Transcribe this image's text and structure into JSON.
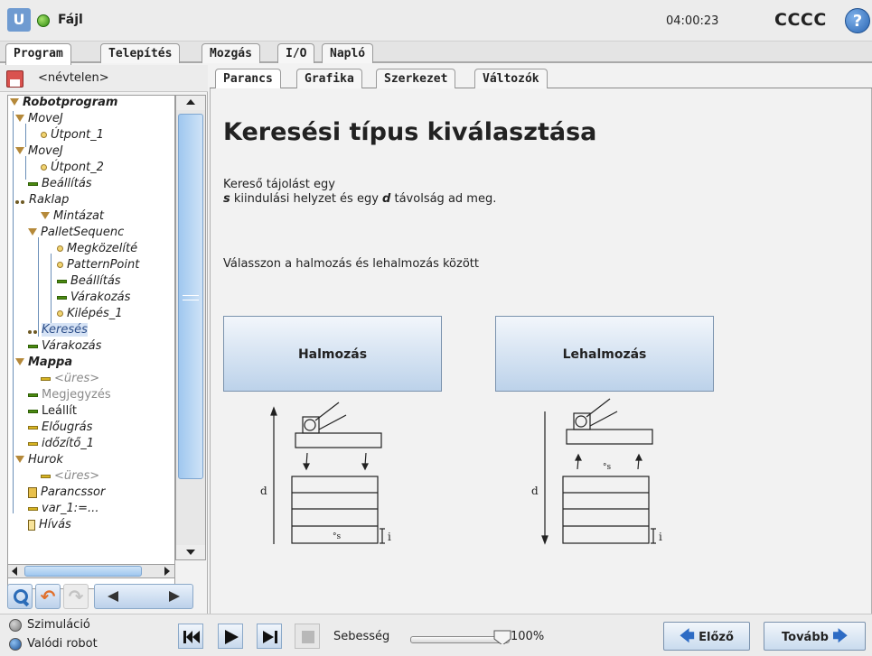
{
  "titlebar": {
    "file_menu": "Fájl",
    "clock": "04:00:23",
    "robot_name": "CCCC",
    "help_symbol": "?",
    "logo_text": "U"
  },
  "main_tabs": [
    "Program",
    "Telepítés",
    "Mozgás",
    "I/O",
    "Napló"
  ],
  "program": {
    "name": "<névtelen>"
  },
  "tree": [
    {
      "label": "Robotprogram",
      "icon": "triangle-icon"
    },
    {
      "label": "MoveJ",
      "icon": "triangle-icon"
    },
    {
      "label": "Útpont_1",
      "icon": "waypoint-icon"
    },
    {
      "label": "MoveJ",
      "icon": "triangle-icon"
    },
    {
      "label": "Útpont_2",
      "icon": "waypoint-icon"
    },
    {
      "label": "Beállítás",
      "icon": "set-icon"
    },
    {
      "label": "Raklap",
      "icon": "pallet-icon"
    },
    {
      "label": "Mintázat",
      "icon": "triangle-icon"
    },
    {
      "label": "PalletSequenc",
      "icon": "triangle-icon"
    },
    {
      "label": "Megközelíté",
      "icon": "waypoint-icon"
    },
    {
      "label": "PatternPoint",
      "icon": "waypoint-icon"
    },
    {
      "label": "Beállítás",
      "icon": "set-icon"
    },
    {
      "label": "Várakozás",
      "icon": "wait-icon"
    },
    {
      "label": "Kilépés_1",
      "icon": "waypoint-icon"
    },
    {
      "label": "Keresés",
      "icon": "pallet-icon"
    },
    {
      "label": "Várakozás",
      "icon": "wait-icon"
    },
    {
      "label": "Mappa",
      "icon": "triangle-icon"
    },
    {
      "label": "<üres>",
      "icon": "empty-icon"
    },
    {
      "label": "Megjegyzés",
      "icon": "comment-icon"
    },
    {
      "label": "Leállít",
      "icon": "halt-icon"
    },
    {
      "label": "Előugrás",
      "icon": "popup-icon"
    },
    {
      "label": "időzítő_1",
      "icon": "timer-icon"
    },
    {
      "label": "Hurok",
      "icon": "triangle-icon"
    },
    {
      "label": "<üres>",
      "icon": "empty-icon"
    },
    {
      "label": "Parancssor",
      "icon": "script-icon"
    },
    {
      "label": "var_1:=...",
      "icon": "assignment-icon"
    },
    {
      "label": "Hívás",
      "icon": "call-icon"
    }
  ],
  "sub_tabs": [
    "Parancs",
    "Grafika",
    "Szerkezet",
    "Változók"
  ],
  "content": {
    "heading": "Keresési típus kiválasztása",
    "desc_line1": "Kereső tájolást egy",
    "desc_s": "s",
    "desc_line2a": " kiindulási helyzet és egy ",
    "desc_d": "d",
    "desc_line2b": " távolság ad meg.",
    "choose_text": "Válasszon a halmozás és lehalmozás között",
    "stack_button": "Halmozás",
    "destack_button": "Lehalmozás",
    "diagram_d": "d",
    "diagram_s": "°s",
    "diagram_i": "i"
  },
  "bottom": {
    "simulation_label": "Szimuláció",
    "real_robot_label": "Valódi robot",
    "selected_mode": "Valódi robot",
    "speed_label": "Sebesség",
    "speed_value": "100%",
    "speed_fraction": 1.0,
    "prev_button": "Előző",
    "next_button": "Tovább"
  }
}
